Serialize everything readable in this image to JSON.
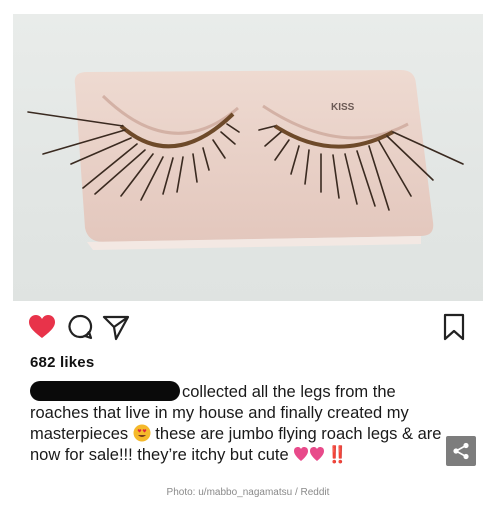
{
  "post": {
    "image_alt": "Fake eyelashes made from insect legs on a KISS lash tray",
    "tray_brand": "KISS",
    "likes": "682 likes",
    "caption_line1": "collected all the legs from the",
    "caption_line2": "roaches that live in my house and finally created my",
    "caption_line3a": "masterpieces",
    "caption_line3b": " these are jumbo flying roach legs & are",
    "caption_line4a": "now for sale!!! they’re itchy but cute",
    "caption_line4b": "‼️"
  },
  "icons": {
    "like": "heart-icon",
    "comment": "comment-icon",
    "share": "send-icon",
    "save": "bookmark-icon",
    "share_overlay": "share-icon"
  },
  "colors": {
    "heart": "#e8334a",
    "exclaim": "#e2203a",
    "credit": "#8a8a8a"
  },
  "credit": "Photo: u/mabbo_nagamatsu / Reddit"
}
